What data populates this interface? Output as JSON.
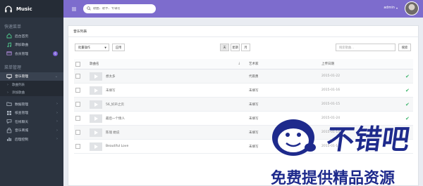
{
  "app": {
    "title": "Music"
  },
  "header": {
    "search_placeholder": "歌曲、歌手、专辑名",
    "user": "admin"
  },
  "sidebar": {
    "section1": "快速菜单",
    "quick": [
      {
        "label": "后台首页",
        "icon": "home-icon"
      },
      {
        "label": "添加歌曲",
        "icon": "music-note-icon"
      },
      {
        "label": "会员管理",
        "icon": "credit-card-icon",
        "badge": "6"
      }
    ],
    "section2": "菜单管理",
    "menu": [
      {
        "label": "音乐管理",
        "icon": "monitor-icon"
      },
      {
        "label": "歌曲列表"
      },
      {
        "label": "添加歌曲"
      },
      {
        "label": "数据管理",
        "icon": "folder-icon"
      },
      {
        "label": "核查管理",
        "icon": "grid-icon"
      },
      {
        "label": "在线聊天",
        "icon": "chat-icon"
      },
      {
        "label": "音乐商城",
        "icon": "shop-icon"
      },
      {
        "label": "后理控制",
        "icon": "chart-icon"
      }
    ]
  },
  "panel": {
    "title": "音乐列表",
    "bulk_label": "批量操作",
    "apply": "应用",
    "seg": [
      "天",
      "星期",
      "月"
    ],
    "search_placeholder": "搜索歌曲...",
    "search_button": "搜索"
  },
  "table": {
    "headers": {
      "name": "歌曲名",
      "artist": "艺术家",
      "date": "上传日期"
    },
    "rows": [
      {
        "name": "想太多",
        "artist": "代雨勇",
        "date": "2015-01-22",
        "checked": true
      },
      {
        "name": "未填写",
        "artist": "未填写",
        "date": "2015-01-16",
        "checked": true
      },
      {
        "name": "56_好声之页",
        "artist": "未填写",
        "date": "2015-01-15",
        "checked": true
      },
      {
        "name": "最后一个情人",
        "artist": "未填写",
        "date": "2015-01-24",
        "checked": true
      },
      {
        "name": "陈瑞 她说",
        "artist": "未填写",
        "date": "2015-01-14",
        "checked": true
      },
      {
        "name": "Beautiful Love",
        "artist": "未填写",
        "date": "2015-01-14",
        "checked": false
      }
    ]
  },
  "watermark": {
    "big": "不错吧",
    "sub": "免费提供精品资源"
  },
  "colors": {
    "sidebar": "#2c3440",
    "header": "#7d6ccd",
    "check": "#3bb46a",
    "watermark": "#1e2a8c"
  }
}
